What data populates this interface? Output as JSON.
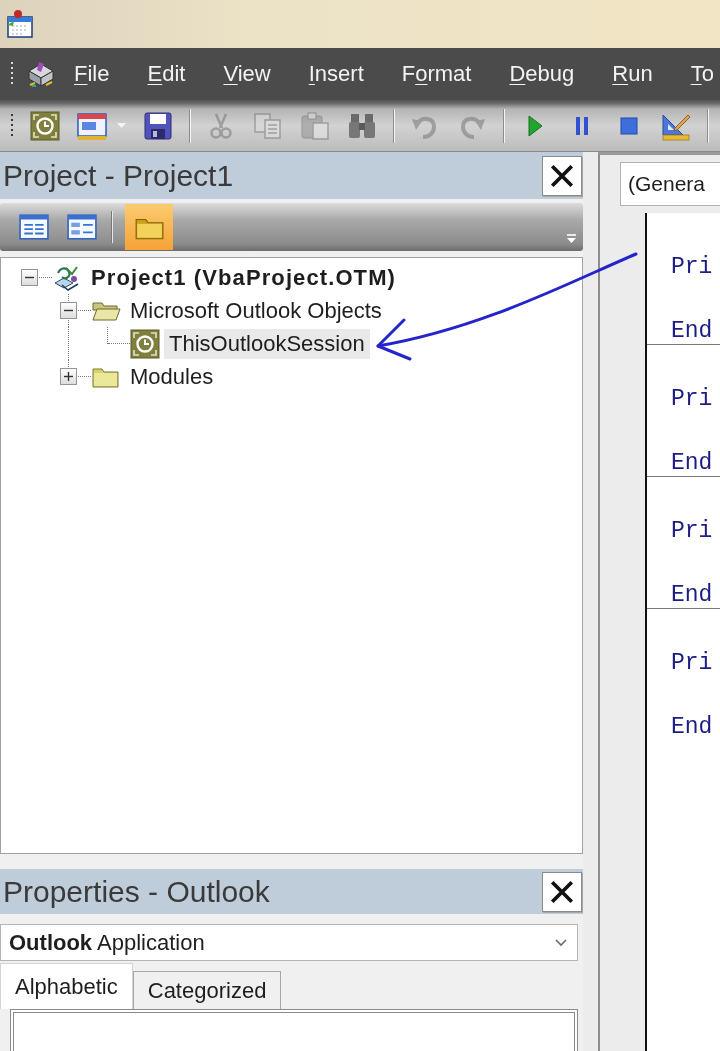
{
  "menu_bar": {
    "items": [
      {
        "key": "F",
        "post": "ile"
      },
      {
        "key": "E",
        "post": "dit"
      },
      {
        "key": "V",
        "post": "iew"
      },
      {
        "key": "I",
        "post": "nsert"
      },
      {
        "pre": "F",
        "key": "o",
        "post": "rmat"
      },
      {
        "key": "D",
        "post": "ebug"
      },
      {
        "key": "R",
        "post": "un"
      },
      {
        "key": "T",
        "post": "o"
      }
    ]
  },
  "toolbar": {
    "groups": [
      [
        {
          "kind": "module",
          "disabled": false
        },
        {
          "kind": "userform",
          "disabled": false
        },
        {
          "kind": "save",
          "disabled": false
        }
      ],
      [
        {
          "kind": "cut",
          "disabled": true
        },
        {
          "kind": "copy",
          "disabled": true
        },
        {
          "kind": "paste",
          "disabled": true
        },
        {
          "kind": "find",
          "disabled": false
        }
      ],
      [
        {
          "kind": "undo",
          "disabled": true
        },
        {
          "kind": "redo",
          "disabled": true
        }
      ],
      [
        {
          "kind": "run",
          "disabled": false
        },
        {
          "kind": "pause",
          "disabled": false
        },
        {
          "kind": "stop",
          "disabled": false
        },
        {
          "kind": "design",
          "disabled": false
        }
      ]
    ]
  },
  "project_pane": {
    "title": "Project - Project1",
    "toolbar": [
      {
        "kind": "code",
        "on": false
      },
      {
        "kind": "object",
        "on": false
      },
      {
        "kind": "folders",
        "on": true
      }
    ],
    "tree": [
      {
        "label": "Project1 (VbaProject.OTM)",
        "kind": "project",
        "expanded": true,
        "selected": false,
        "children": [
          {
            "label": "Microsoft Outlook Objects",
            "kind": "folder",
            "expanded": true,
            "selected": false,
            "children": [
              {
                "label": "ThisOutlookSession",
                "kind": "session",
                "selected": true
              }
            ]
          },
          {
            "label": "Modules",
            "kind": "folder",
            "expanded": false,
            "selected": false
          }
        ]
      }
    ]
  },
  "code_window": {
    "object_box": "(Genera",
    "procedures": [
      {
        "lines": [
          "Pri",
          "End"
        ]
      },
      {
        "lines": [
          "Pri",
          "End"
        ]
      },
      {
        "lines": [
          "Pri",
          "End"
        ]
      },
      {
        "lines": [
          "Pri",
          "End"
        ]
      }
    ]
  },
  "properties_pane": {
    "title": "Properties - Outlook",
    "object_box": "**Outlook** Application",
    "tabs": [
      {
        "label": "Alphabetic",
        "selected": true
      },
      {
        "label": "Categorized",
        "selected": false
      }
    ]
  }
}
